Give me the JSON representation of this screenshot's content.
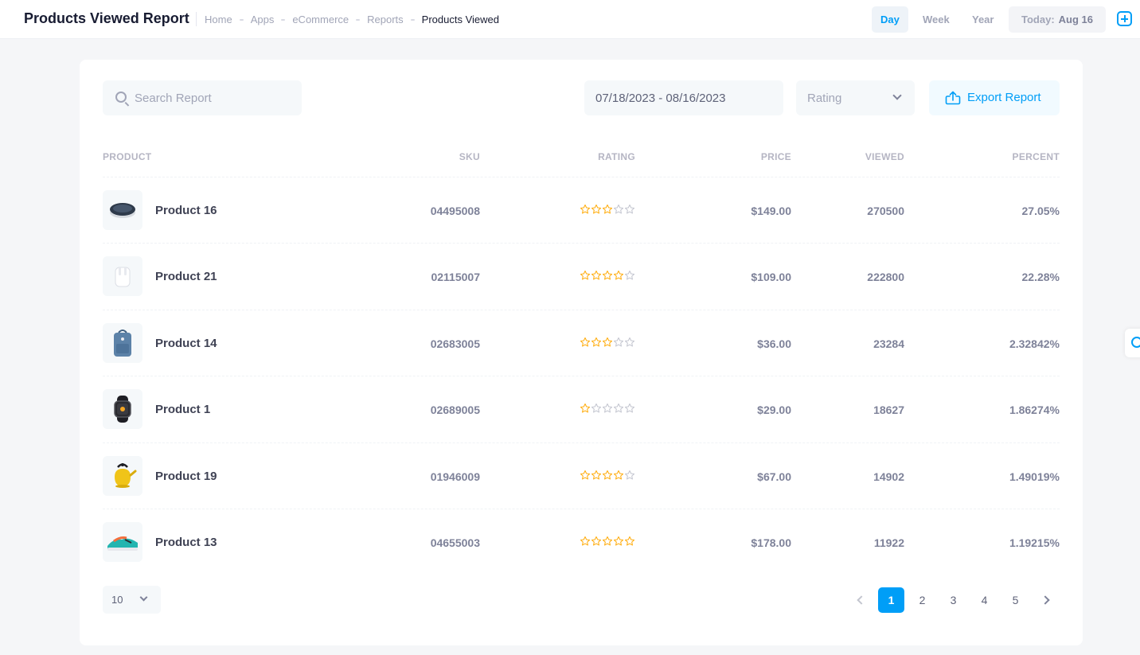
{
  "header": {
    "title": "Products Viewed Report",
    "breadcrumb": [
      "Home",
      "Apps",
      "eCommerce",
      "Reports",
      "Products Viewed"
    ],
    "ranges": [
      "Day",
      "Week",
      "Year"
    ],
    "active_range": "Day",
    "today_label": "Today:",
    "today_value": "Aug 16"
  },
  "toolbar": {
    "search_placeholder": "Search Report",
    "date_range": "07/18/2023 - 08/16/2023",
    "rating_placeholder": "Rating",
    "export_label": "Export Report"
  },
  "table": {
    "columns": [
      "PRODUCT",
      "SKU",
      "RATING",
      "PRICE",
      "VIEWED",
      "PERCENT"
    ],
    "rows": [
      {
        "name": "Product 16",
        "sku": "04495008",
        "rating": 3,
        "price": "$149.00",
        "viewed": "270500",
        "percent": "27.05%",
        "image": "speaker-image"
      },
      {
        "name": "Product 21",
        "sku": "02115007",
        "rating": 4,
        "price": "$109.00",
        "viewed": "222800",
        "percent": "22.28%",
        "image": "earbuds-image"
      },
      {
        "name": "Product 14",
        "sku": "02683005",
        "rating": 3,
        "price": "$36.00",
        "viewed": "23284",
        "percent": "2.32842%",
        "image": "backpack-image"
      },
      {
        "name": "Product 1",
        "sku": "02689005",
        "rating": 1,
        "price": "$29.00",
        "viewed": "18627",
        "percent": "1.86274%",
        "image": "watch-image"
      },
      {
        "name": "Product 19",
        "sku": "01946009",
        "rating": 4,
        "price": "$67.00",
        "viewed": "14902",
        "percent": "1.49019%",
        "image": "kettle-image"
      },
      {
        "name": "Product 13",
        "sku": "04655003",
        "rating": 5,
        "price": "$178.00",
        "viewed": "11922",
        "percent": "1.19215%",
        "image": "sneaker-image"
      }
    ]
  },
  "footer": {
    "per_page": "10",
    "pages": [
      "1",
      "2",
      "3",
      "4",
      "5"
    ],
    "active_page": "1"
  },
  "colors": {
    "accent": "#009ef7",
    "star": "#ffad0f"
  }
}
